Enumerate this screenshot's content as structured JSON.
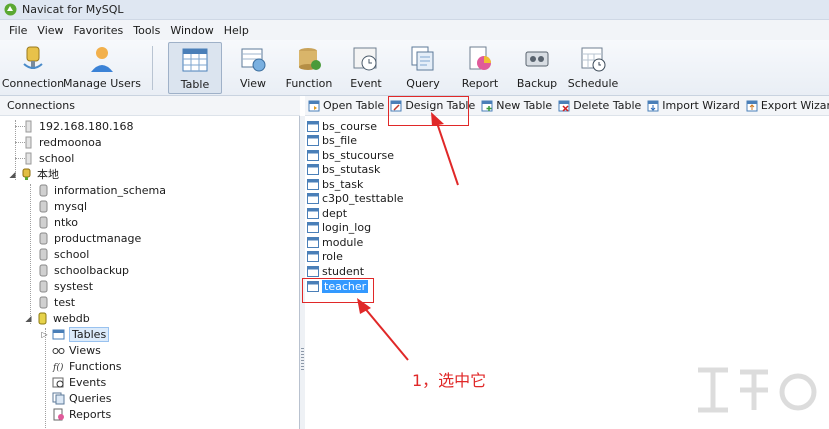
{
  "window": {
    "title": "Navicat for MySQL"
  },
  "menu": [
    "File",
    "View",
    "Favorites",
    "Tools",
    "Window",
    "Help"
  ],
  "toolbar": {
    "items": [
      {
        "label": "Connection",
        "icon": "connection-icon"
      },
      {
        "label": "Manage Users",
        "icon": "users-icon"
      },
      {
        "label": "Table",
        "icon": "table-icon",
        "active": true
      },
      {
        "label": "View",
        "icon": "view-icon"
      },
      {
        "label": "Function",
        "icon": "function-icon"
      },
      {
        "label": "Event",
        "icon": "event-icon"
      },
      {
        "label": "Query",
        "icon": "query-icon"
      },
      {
        "label": "Report",
        "icon": "report-icon"
      },
      {
        "label": "Backup",
        "icon": "backup-icon"
      },
      {
        "label": "Schedule",
        "icon": "schedule-icon"
      }
    ]
  },
  "connections": {
    "header": "Connections",
    "servers": [
      "192.168.180.168",
      "redmoonoa",
      "school",
      "本地"
    ],
    "databases": [
      "information_schema",
      "mysql",
      "ntko",
      "productmanage",
      "school",
      "schoolbackup",
      "systest",
      "test",
      "webdb"
    ],
    "webdb_children": [
      "Tables",
      "Views",
      "Functions",
      "Events",
      "Queries",
      "Reports"
    ]
  },
  "actions": [
    "Open Table",
    "Design Table",
    "New Table",
    "Delete Table",
    "Import Wizard",
    "Export Wizard"
  ],
  "tables": [
    "bs_course",
    "bs_file",
    "bs_stucourse",
    "bs_stutask",
    "bs_task",
    "c3p0_testtable",
    "dept",
    "login_log",
    "module",
    "role",
    "student",
    "teacher"
  ],
  "selected_table": "teacher",
  "annotation": {
    "text": "1，选中它",
    "color": "#e02828"
  },
  "colors": {
    "selection": "#3399ff",
    "annotation": "#e02828"
  }
}
